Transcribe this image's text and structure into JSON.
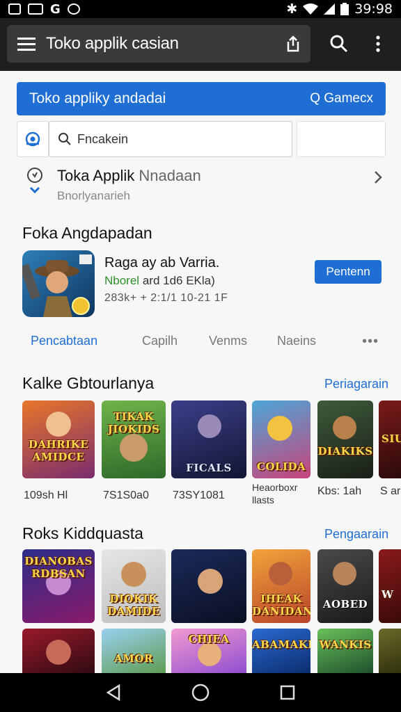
{
  "status_bar": {
    "time": "39:98",
    "icons": [
      "notification-icon",
      "image-icon",
      "sync-icon",
      "circle-icon",
      "bluetooth-icon",
      "wifi-icon",
      "signal-icon",
      "battery-icon"
    ]
  },
  "app_bar": {
    "title": "Toko applik casian",
    "icons": [
      "menu-icon",
      "share-icon",
      "search-icon",
      "more-vert-icon"
    ]
  },
  "banner": {
    "title": "Toko appliky andadai",
    "link": "Q Gamecx",
    "color": "#1f6ed4"
  },
  "filter": {
    "placeholder": "Fncakein"
  },
  "info_row": {
    "title": "Toka Applik",
    "title_suffix": "Nnadaan",
    "subtitle": "Bnorlyanarieh"
  },
  "featured": {
    "section_title": "Foka Angdapadan",
    "app_name": "Raga ay ab Varria.",
    "meta_green": "Nborel",
    "meta_dark": "ard 1d6 EKla)",
    "meta_line2": "283k+ + 2:1/1 10-21 1F",
    "install_label": "Pentenn"
  },
  "tabs": [
    {
      "label": "Pencabtaan",
      "active": true
    },
    {
      "label": "Capilh",
      "active": false
    },
    {
      "label": "Venms",
      "active": false
    },
    {
      "label": "Naeins",
      "active": false
    }
  ],
  "tabs_more": "•••",
  "section2": {
    "title": "Kalke Gbtourlanya",
    "link": "Periagarain",
    "tiles": [
      {
        "art_text": "DAHRIKE AMIDCE",
        "label": "109sh Hl"
      },
      {
        "art_text": "TIKAK JIOKIDS",
        "label": "7S1S0a0"
      },
      {
        "art_text": "FICALS",
        "label": "73SY1081"
      },
      {
        "art_text": "COLIDA",
        "label": "Heaorboxr llasts"
      },
      {
        "art_text": "DIAKIKS",
        "label": "Kbs: 1ah"
      },
      {
        "art_text": "SIUE",
        "label": "S ar"
      }
    ]
  },
  "section3": {
    "title": "Roks Kiddquasta",
    "link": "Pengaarain",
    "tiles_row1": [
      {
        "art_text": "DIANOBAS RDBSAN"
      },
      {
        "art_text": "DIOKIK DAMIDE"
      },
      {
        "art_text": ""
      },
      {
        "art_text": "IHEAK DANIDAN"
      },
      {
        "art_text": "AOBED"
      },
      {
        "art_text": "W"
      }
    ],
    "tiles_row2": [
      {
        "art_text": ""
      },
      {
        "art_text": "AMOR"
      },
      {
        "art_text": "CHIEA"
      },
      {
        "art_text": "ABAMAKIS"
      },
      {
        "art_text": "WANKIS"
      },
      {
        "art_text": ""
      }
    ]
  }
}
